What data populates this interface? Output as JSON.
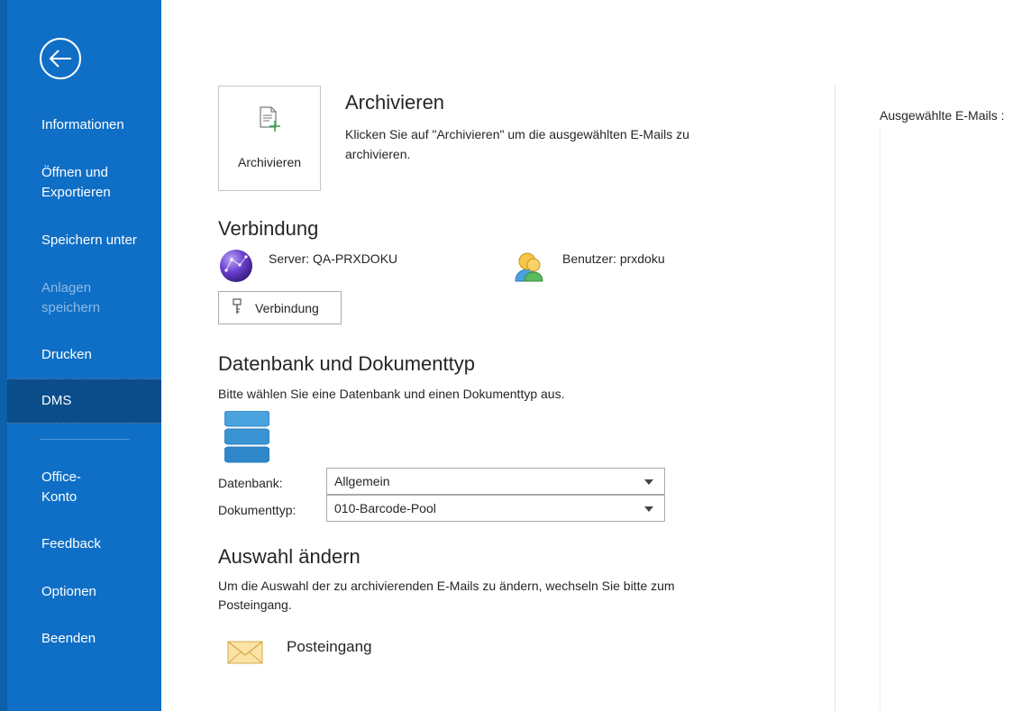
{
  "sidebar": {
    "back_icon": "back-arrow-circle-icon",
    "items": [
      {
        "label": "Informationen"
      },
      {
        "label": "Öffnen und"
      },
      {
        "label": "Exportieren"
      },
      {
        "label": "Speichern unter"
      },
      {
        "label": "Anlagen"
      },
      {
        "label": "speichern"
      },
      {
        "label": "Drucken"
      },
      {
        "label": "DMS"
      },
      {
        "label": "Office-"
      },
      {
        "label": "Konto"
      },
      {
        "label": "Feedback"
      },
      {
        "label": "Optionen"
      },
      {
        "label": "Beenden"
      }
    ]
  },
  "archive": {
    "tile_label": "Archivieren",
    "title": "Archivieren",
    "desc_line1": "Klicken Sie auf \"Archivieren\" um die ausgewählten E-Mails zu",
    "desc_line2": "archivieren."
  },
  "connection": {
    "title": "Verbindung",
    "server": "Server: QA-PRXDOKU",
    "user": "Benutzer: prxdoku",
    "button_label": "Verbindung"
  },
  "database": {
    "title": "Datenbank und Dokumenttyp",
    "desc": "Bitte wählen Sie eine Datenbank und einen Dokumenttyp aus.",
    "db_label": "Datenbank:",
    "db_value": "Allgemein",
    "doctype_label": "Dokumenttyp:",
    "doctype_value": "010-Barcode-Pool"
  },
  "selection": {
    "title": "Auswahl ändern",
    "desc_line1": "Um die Auswahl der zu archivierenden E-Mails zu ändern, wechseln Sie bitte zum",
    "desc_line2": "Posteingang.",
    "inbox_label": "Posteingang"
  },
  "right": {
    "label": "Ausgewählte E-Mails :"
  },
  "colors": {
    "sidebar": "#0f6fc6",
    "sidebar_selected": "#0b4d8b"
  }
}
